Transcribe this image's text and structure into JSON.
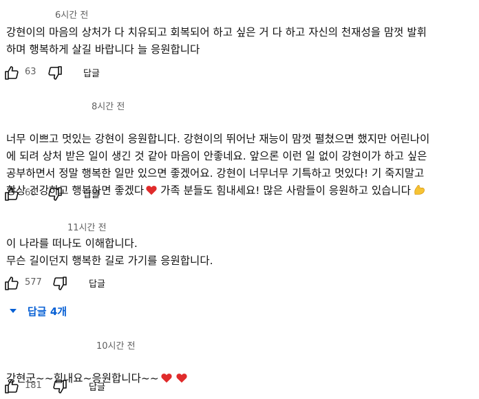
{
  "comments": [
    {
      "timestamp": "6시간 전",
      "text": "강현이의 마음의 상처가 다 치유되고 회복되어 하고 싶은 거 다 하고 자신의 천재성을 맘껏 발휘\n하며 행복하게 살길 바랍니다 늘 응원합니다",
      "likes": "63",
      "reply_label": "답글"
    },
    {
      "timestamp": "8시간 전",
      "text_before_heart": "너무 이쁘고 멋있는 강현이 응원합니다. 강현이의 뛰어난 재능이 맘껏 펼쳤으면 했지만 어린나이\n에 되려 상처 받은 일이 생긴 것 같아 마음이 안좋네요. 앞으론 이런 일 없이 강현이가 하고 싶은\n공부하면서 정말 행복한 일만 있으면 좋겠어요. 강현이 너무너무 기특하고 멋있다! 기 죽지말고\n항상 건강하고 행복하면 좋겠다",
      "text_after_heart": " 가족 분들도 힘내세요! 많은 사람들이 응원하고 있습니다",
      "likes": "68",
      "reply_label": "답글"
    },
    {
      "timestamp": "11시간 전",
      "text": "이 나라를 떠나도 이해합니다.\n무슨 길이던지 행복한 길로 가기를 응원합니다.",
      "likes": "577",
      "reply_label": "답글",
      "replies_toggle": "답글 4개"
    },
    {
      "timestamp": "10시간 전",
      "text": "강현군~~힘내요~응원합니다~~",
      "likes": "181",
      "reply_label": "답글"
    }
  ],
  "colors": {
    "heart": "#e02b2b",
    "link": "#065fd4",
    "muted": "#606060",
    "flex_arm": "#f6c333"
  },
  "icons": [
    "thumbs-up-icon",
    "thumbs-down-icon",
    "heart-emoji-icon",
    "flexed-biceps-emoji-icon",
    "caret-down-icon"
  ]
}
